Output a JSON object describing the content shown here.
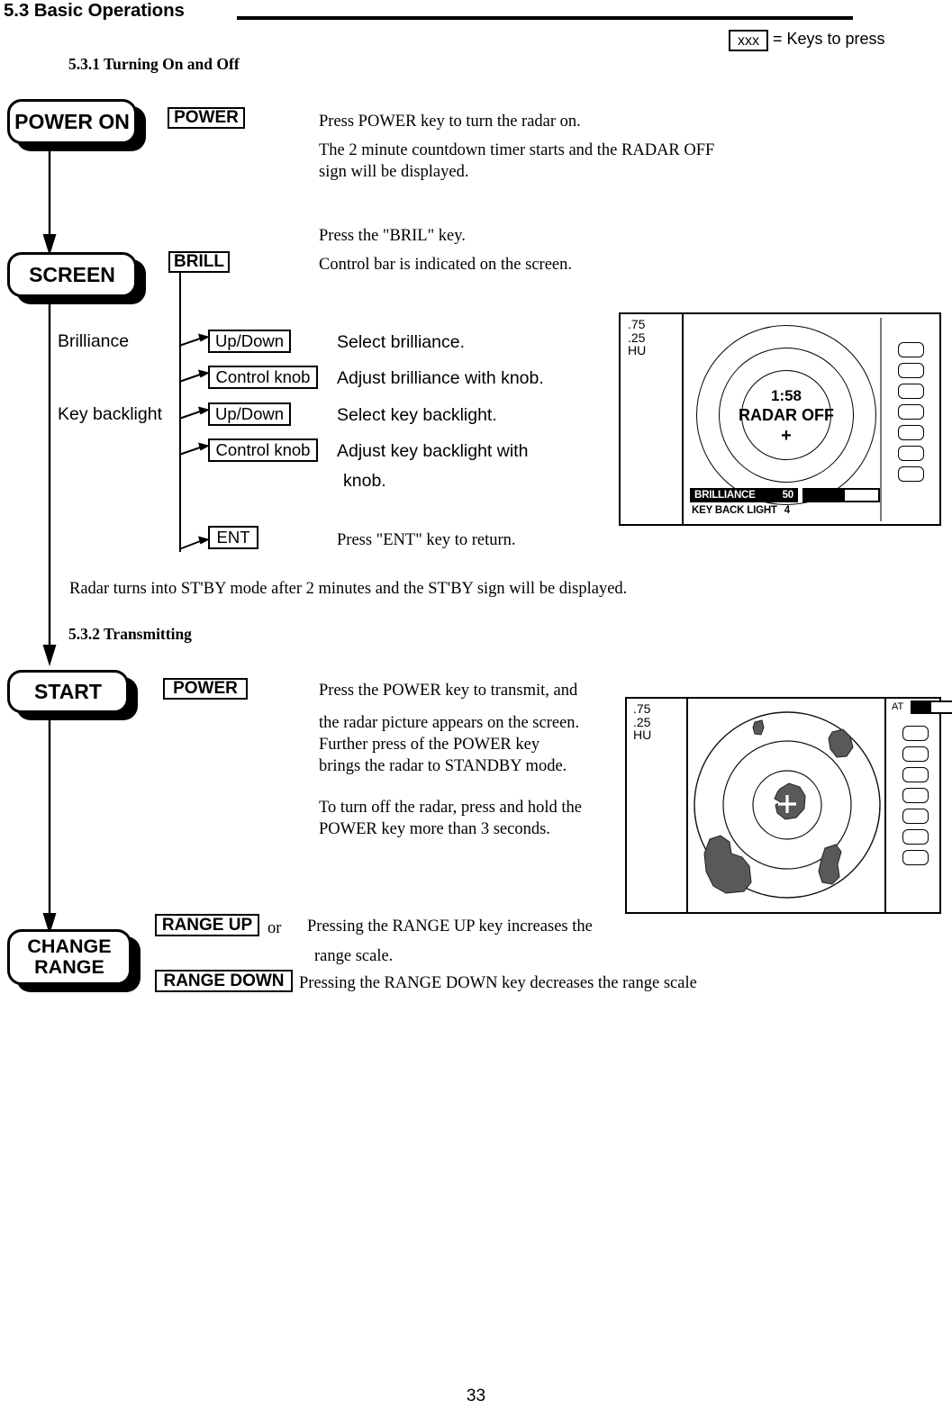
{
  "page": {
    "section_number_title": "5.3 Basic Operations",
    "page_number": "33"
  },
  "legend": {
    "key_sample": "xxx",
    "description": "= Keys to press"
  },
  "subsections": [
    {
      "id": "5.3.1",
      "heading": "5.3.1 Turning On and Off"
    },
    {
      "id": "5.3.2",
      "heading": "5.3.2 Transmitting"
    }
  ],
  "flow": {
    "power_on": {
      "label": "POWER ON"
    },
    "screen": {
      "label": "SCREEN"
    },
    "start": {
      "label": "START"
    },
    "change_range": {
      "label_line1": "CHANGE",
      "label_line2": "RANGE"
    }
  },
  "steps": {
    "power_on": {
      "key": "POWER",
      "text_line1": "Press POWER key to turn the radar on.",
      "text_line2": "The 2 minute countdown timer starts and the RADAR OFF",
      "text_line3": "sign will be displayed."
    },
    "screen": {
      "key": "BRILL",
      "text_line1": "Press the \"BRIL\" key.",
      "text_line2": "Control bar is indicated on the screen."
    },
    "brilliance_label": "Brilliance",
    "key_backlight_label": "Key backlight",
    "branches": [
      {
        "key": "Up/Down",
        "text": "Select brilliance."
      },
      {
        "key": "Control knob",
        "text": "Adjust brilliance with knob."
      },
      {
        "key": "Up/Down",
        "text": "Select key backlight."
      },
      {
        "key": "Control knob",
        "text": "Adjust key backlight with",
        "text2": "knob."
      },
      {
        "key": "ENT",
        "text": "Press \"ENT\" key to return."
      }
    ],
    "standby_note": "Radar turns into ST'BY mode after 2 minutes and the ST'BY sign will be displayed.",
    "start": {
      "key": "POWER",
      "text_line1": "Press the POWER key to transmit, and",
      "text_line2": "the radar picture appears on the screen.",
      "text_line3": "Further press of the POWER key",
      "text_line4": "brings the radar to STANDBY mode.",
      "text_line5": "To turn off the radar, press and hold the",
      "text_line6": "POWER key more than 3 seconds."
    },
    "change_range": {
      "key_up": "RANGE UP",
      "or_word": "or",
      "text_up_line1": "Pressing the RANGE UP key increases the",
      "text_up_line2": "range scale.",
      "key_down": "RANGE DOWN",
      "text_down": "Pressing the RANGE DOWN key decreases the range scale"
    }
  },
  "radar_display_1": {
    "range_labels": ".75\n.25\nHU",
    "timer": "1:58",
    "status": "RADAR OFF",
    "center_marker": "+",
    "brilliance_bar": {
      "label": "BRILLIANCE",
      "value": "50",
      "fill_percent": 55
    },
    "key_backlight": {
      "label": "KEY BACK LIGHT",
      "value": "4"
    },
    "softkey_count": 7
  },
  "radar_display_2": {
    "range_labels": ".75\n.25\nHU",
    "center_marker": "+",
    "at_indicator": {
      "label": "AT",
      "fill_percent": 38
    },
    "softkey_count": 7,
    "echo_color": "#595959",
    "ring_count": 3
  }
}
